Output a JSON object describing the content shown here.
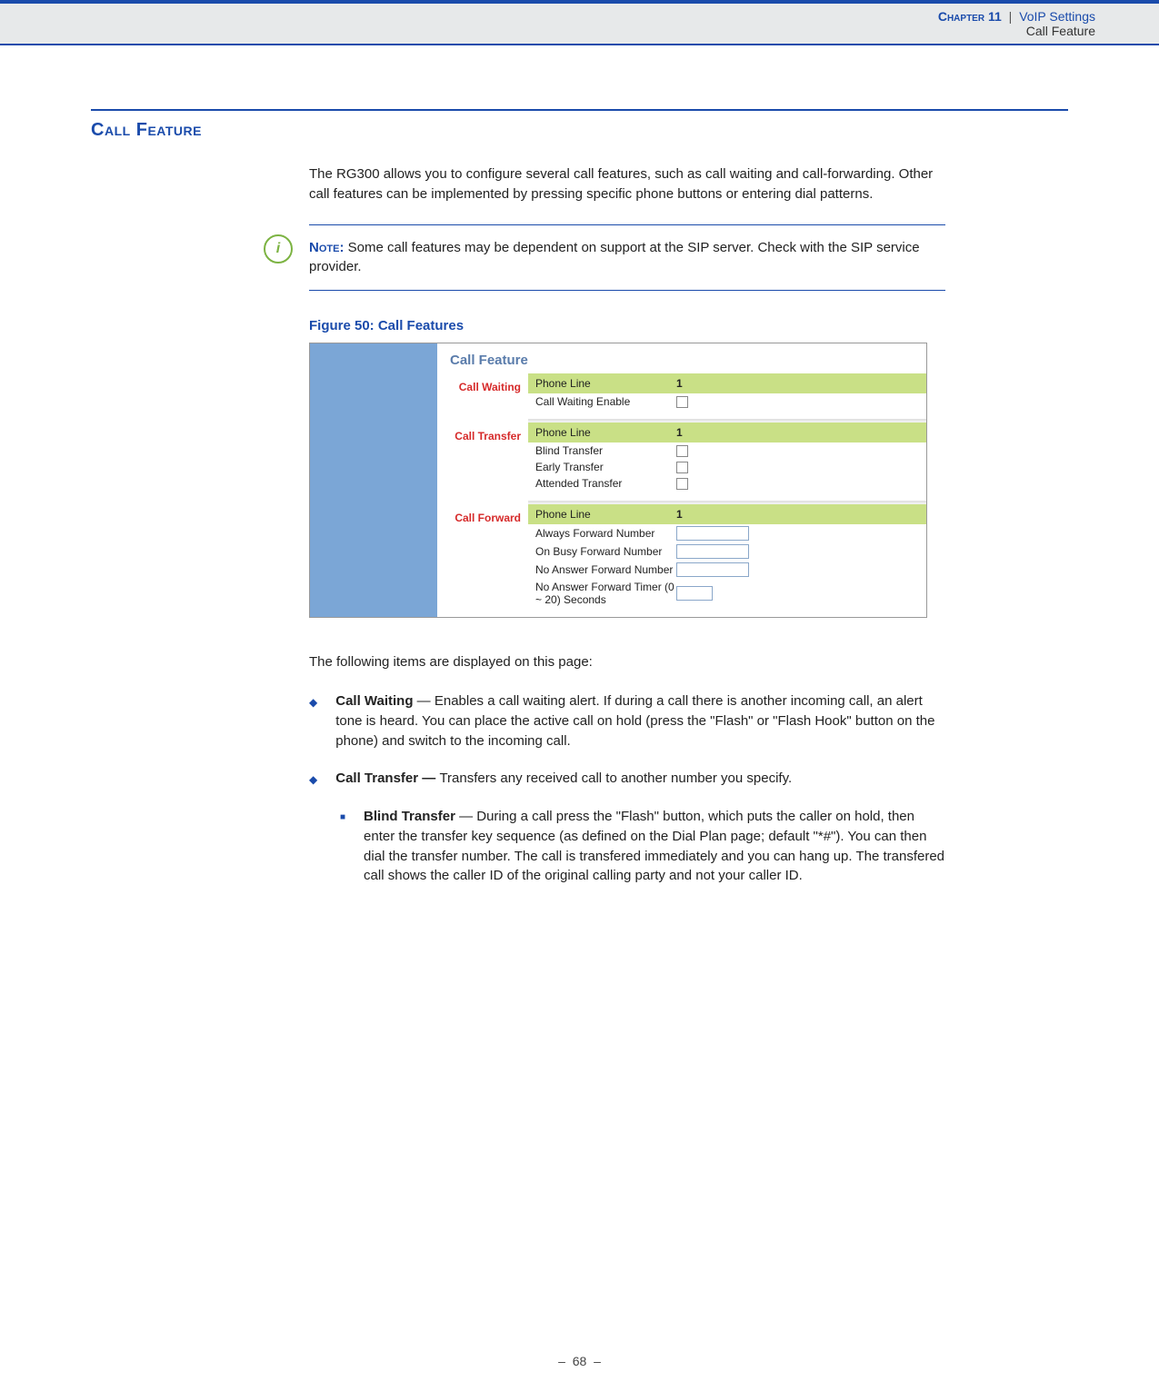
{
  "header": {
    "chapter": "Chapter 11",
    "separator": "|",
    "section": "VoIP Settings",
    "subsection": "Call Feature"
  },
  "title": {
    "first": "C",
    "rest": "all Feature"
  },
  "intro": "The RG300 allows you to configure several call features, such as call waiting and call-forwarding. Other call features can be implemented by pressing specific phone buttons or entering dial patterns.",
  "note": {
    "icon": "i",
    "label": "Note:",
    "text": " Some call features may be dependent on support at the SIP server. Check with the SIP service provider."
  },
  "figure": {
    "caption": "Figure 50:  Call Features",
    "panel_title": "Call Feature",
    "groups": {
      "waiting": {
        "label": "Call Waiting",
        "header_left": "Phone Line",
        "header_right": "1",
        "rows": [
          {
            "label": "Call Waiting Enable",
            "control": "checkbox"
          }
        ]
      },
      "transfer": {
        "label": "Call Transfer",
        "header_left": "Phone Line",
        "header_right": "1",
        "rows": [
          {
            "label": "Blind Transfer",
            "control": "checkbox"
          },
          {
            "label": "Early Transfer",
            "control": "checkbox"
          },
          {
            "label": "Attended Transfer",
            "control": "checkbox"
          }
        ]
      },
      "forward": {
        "label": "Call Forward",
        "header_left": "Phone Line",
        "header_right": "1",
        "rows": [
          {
            "label": "Always Forward Number",
            "control": "input"
          },
          {
            "label": "On Busy Forward Number",
            "control": "input"
          },
          {
            "label": "No Answer Forward Number",
            "control": "input"
          },
          {
            "label": "No Answer Forward Timer (0 ~ 20) Seconds",
            "control": "input-sm"
          }
        ]
      }
    }
  },
  "following": "The following items are displayed on this page:",
  "bullets": {
    "b1": {
      "term": "Call Waiting",
      "text": " — Enables a call waiting alert. If during a call there is another incoming call, an alert tone is heard. You can place the active call on hold (press the \"Flash\" or \"Flash Hook\" button on the phone) and switch to the incoming call."
    },
    "b2": {
      "term": "Call Transfer — ",
      "text": "Transfers any received call to another number you specify."
    },
    "sub1": {
      "term": "Blind Transfer",
      "text": " — During a call press the \"Flash\" button, which puts the caller on hold, then enter the transfer key sequence (as defined on the Dial Plan page; default \"*#\"). You can then dial the transfer number. The call is transfered immediately and you can hang up. The transfered call shows the caller ID of the original calling party and not your caller ID."
    }
  },
  "footer": {
    "dash_left": "–",
    "page": "68",
    "dash_right": "–"
  }
}
